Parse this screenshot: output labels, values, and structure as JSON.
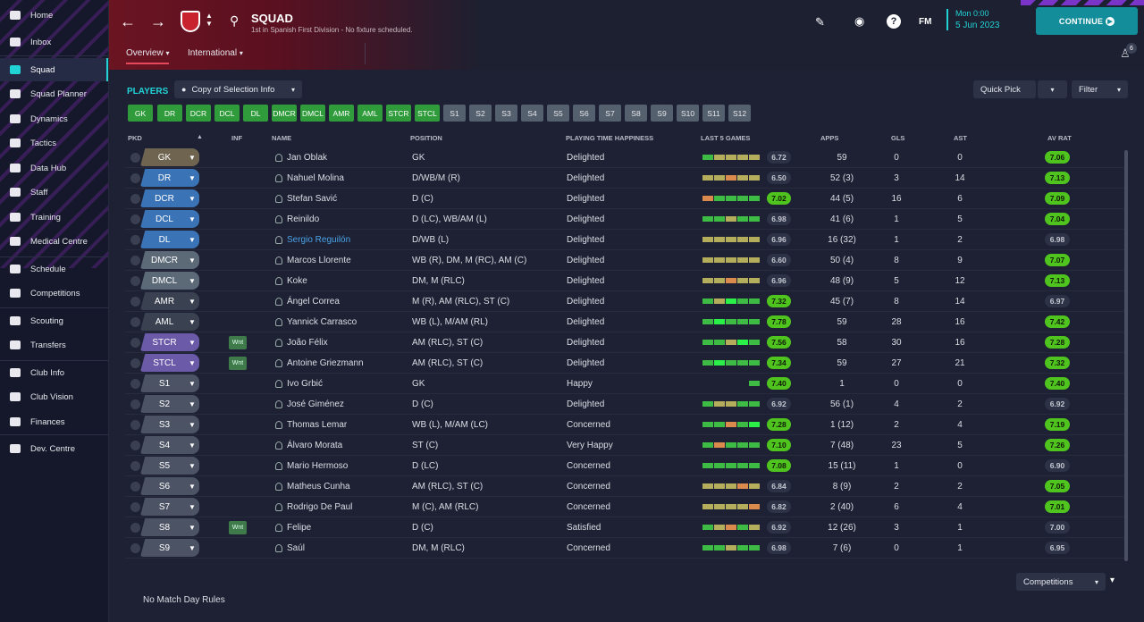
{
  "nav": [
    {
      "label": "Home",
      "icon": "home-icon"
    },
    {
      "label": "Inbox",
      "icon": "inbox-icon"
    },
    {
      "label": "Squad",
      "icon": "squad-icon",
      "active": true
    },
    {
      "label": "Squad Planner",
      "icon": "clipboard-icon"
    },
    {
      "label": "Dynamics",
      "icon": "dynamics-icon"
    },
    {
      "label": "Tactics",
      "icon": "tactics-icon"
    },
    {
      "label": "Data Hub",
      "icon": "data-hub-icon"
    },
    {
      "label": "Staff",
      "icon": "staff-icon"
    },
    {
      "label": "Training",
      "icon": "training-icon"
    },
    {
      "label": "Medical Centre",
      "icon": "medical-icon"
    },
    {
      "label": "Schedule",
      "icon": "calendar-icon"
    },
    {
      "label": "Competitions",
      "icon": "trophy-icon"
    },
    {
      "label": "Scouting",
      "icon": "scouting-icon"
    },
    {
      "label": "Transfers",
      "icon": "transfers-icon"
    },
    {
      "label": "Club Info",
      "icon": "shield-icon"
    },
    {
      "label": "Club Vision",
      "icon": "vision-icon"
    },
    {
      "label": "Finances",
      "icon": "finances-icon"
    },
    {
      "label": "Dev. Centre",
      "icon": "dev-centre-icon"
    }
  ],
  "header": {
    "title": "SQUAD",
    "subtitle": "1st in Spanish First Division - No fixture scheduled.",
    "tabs": [
      "Overview",
      "International"
    ],
    "date_line1": "Mon 0:00",
    "date_line2": "5 Jun 2023",
    "fm": "FM",
    "continue": "CONTINUE",
    "notif_count": "6"
  },
  "toolbar": {
    "players": "PLAYERS",
    "copy": "Copy of Selection Info",
    "quick_pick": "Quick Pick",
    "filter": "Filter"
  },
  "positions": [
    "GK",
    "DR",
    "DCR",
    "DCL",
    "DL",
    "DMCR",
    "DMCL",
    "AMR",
    "AML",
    "STCR",
    "STCL",
    "S1",
    "S2",
    "S3",
    "S4",
    "S5",
    "S6",
    "S7",
    "S8",
    "S9",
    "S10",
    "S11",
    "S12"
  ],
  "columns": {
    "pkd": "PKD",
    "inf": "INF",
    "name": "NAME",
    "position": "POSITION",
    "happiness": "PLAYING TIME HAPPINESS",
    "last5": "LAST 5 GAMES",
    "apps": "APPS",
    "gls": "GLS",
    "ast": "AST",
    "avrat": "AV RAT"
  },
  "colors": {
    "accent": "#22d3d6",
    "continue_bg": "#148d9a",
    "rating_green": "#4fc41e",
    "form_green": "#2fc43a",
    "form_olive": "#b8b05a",
    "form_orange": "#d8884a"
  },
  "players": [
    {
      "sel": "GK",
      "name": "Jan Oblak",
      "pos": "GK",
      "happy": "Delighted",
      "form": [
        "g",
        "o",
        "o",
        "o",
        "o"
      ],
      "fr": "6.72",
      "apps": "59",
      "gls": "0",
      "ast": "0",
      "av": "7.06"
    },
    {
      "sel": "DR",
      "name": "Nahuel Molina",
      "pos": "D/WB/M (R)",
      "happy": "Delighted",
      "form": [
        "o",
        "o",
        "r",
        "o",
        "o"
      ],
      "fr": "6.50",
      "apps": "52 (3)",
      "gls": "3",
      "ast": "14",
      "av": "7.13"
    },
    {
      "sel": "DCR",
      "name": "Stefan Savić",
      "pos": "D (C)",
      "happy": "Delighted",
      "form": [
        "r",
        "g",
        "g",
        "g",
        "g"
      ],
      "fr": "7.02",
      "apps": "44 (5)",
      "gls": "16",
      "ast": "6",
      "av": "7.09"
    },
    {
      "sel": "DCL",
      "name": "Reinildo",
      "pos": "D (LC), WB/AM (L)",
      "happy": "Delighted",
      "form": [
        "g",
        "g",
        "o",
        "g",
        "g"
      ],
      "fr": "6.98",
      "apps": "41 (6)",
      "gls": "1",
      "ast": "5",
      "av": "7.04"
    },
    {
      "sel": "DL",
      "name": "Sergio Reguilón",
      "pos": "D/WB (L)",
      "happy": "Delighted",
      "form": [
        "o",
        "o",
        "o",
        "o",
        "o"
      ],
      "fr": "6.96",
      "apps": "16 (32)",
      "gls": "1",
      "ast": "2",
      "av": "6.98",
      "link": true
    },
    {
      "sel": "DMCR",
      "name": "Marcos Llorente",
      "pos": "WB (R), DM, M (RC), AM (C)",
      "happy": "Delighted",
      "form": [
        "o",
        "o",
        "o",
        "o",
        "o"
      ],
      "fr": "6.60",
      "apps": "50 (4)",
      "gls": "8",
      "ast": "9",
      "av": "7.07"
    },
    {
      "sel": "DMCL",
      "name": "Koke",
      "pos": "DM, M (RLC)",
      "happy": "Delighted",
      "form": [
        "o",
        "o",
        "r",
        "o",
        "o"
      ],
      "fr": "6.96",
      "apps": "48 (9)",
      "gls": "5",
      "ast": "12",
      "av": "7.13"
    },
    {
      "sel": "AMR",
      "name": "Ángel Correa",
      "pos": "M (R), AM (RLC), ST (C)",
      "happy": "Delighted",
      "form": [
        "g",
        "o",
        "G",
        "g",
        "g"
      ],
      "fr": "7.32",
      "apps": "45 (7)",
      "gls": "8",
      "ast": "14",
      "av": "6.97"
    },
    {
      "sel": "AML",
      "name": "Yannick Carrasco",
      "pos": "WB (L), M/AM (RL)",
      "happy": "Delighted",
      "form": [
        "g",
        "G",
        "g",
        "g",
        "g"
      ],
      "fr": "7.78",
      "apps": "59",
      "gls": "28",
      "ast": "16",
      "av": "7.42"
    },
    {
      "sel": "STCR",
      "name": "João Félix",
      "pos": "AM (RLC), ST (C)",
      "happy": "Delighted",
      "form": [
        "g",
        "g",
        "o",
        "G",
        "g"
      ],
      "fr": "7.56",
      "apps": "58",
      "gls": "30",
      "ast": "16",
      "av": "7.28",
      "inf": "Wnt"
    },
    {
      "sel": "STCL",
      "name": "Antoine Griezmann",
      "pos": "AM (RLC), ST (C)",
      "happy": "Delighted",
      "form": [
        "g",
        "G",
        "g",
        "g",
        "g"
      ],
      "fr": "7.34",
      "apps": "59",
      "gls": "27",
      "ast": "21",
      "av": "7.32",
      "inf": "Wnt"
    },
    {
      "sel": "S1",
      "name": "Ivo Grbić",
      "pos": "GK",
      "happy": "Happy",
      "form": [
        "g"
      ],
      "fr": "7.40",
      "apps": "1",
      "gls": "0",
      "ast": "0",
      "av": "7.40"
    },
    {
      "sel": "S2",
      "name": "José Giménez",
      "pos": "D (C)",
      "happy": "Delighted",
      "form": [
        "g",
        "o",
        "o",
        "g",
        "g"
      ],
      "fr": "6.92",
      "apps": "56 (1)",
      "gls": "4",
      "ast": "2",
      "av": "6.92"
    },
    {
      "sel": "S3",
      "name": "Thomas Lemar",
      "pos": "WB (L), M/AM (LC)",
      "happy": "Concerned",
      "form": [
        "g",
        "g",
        "r",
        "g",
        "G"
      ],
      "fr": "7.28",
      "apps": "1 (12)",
      "gls": "2",
      "ast": "4",
      "av": "7.19"
    },
    {
      "sel": "S4",
      "name": "Álvaro Morata",
      "pos": "ST (C)",
      "happy": "Very Happy",
      "form": [
        "g",
        "r",
        "g",
        "g",
        "g"
      ],
      "fr": "7.10",
      "apps": "7 (48)",
      "gls": "23",
      "ast": "5",
      "av": "7.26"
    },
    {
      "sel": "S5",
      "name": "Mario Hermoso",
      "pos": "D (LC)",
      "happy": "Concerned",
      "form": [
        "g",
        "g",
        "g",
        "g",
        "g"
      ],
      "fr": "7.08",
      "apps": "15 (11)",
      "gls": "1",
      "ast": "0",
      "av": "6.90"
    },
    {
      "sel": "S6",
      "name": "Matheus Cunha",
      "pos": "AM (RLC), ST (C)",
      "happy": "Concerned",
      "form": [
        "o",
        "o",
        "o",
        "r",
        "o"
      ],
      "fr": "6.84",
      "apps": "8 (9)",
      "gls": "2",
      "ast": "2",
      "av": "7.05"
    },
    {
      "sel": "S7",
      "name": "Rodrigo De Paul",
      "pos": "M (C), AM (RLC)",
      "happy": "Concerned",
      "form": [
        "o",
        "o",
        "o",
        "o",
        "r"
      ],
      "fr": "6.82",
      "apps": "2 (40)",
      "gls": "6",
      "ast": "4",
      "av": "7.01"
    },
    {
      "sel": "S8",
      "name": "Felipe",
      "pos": "D (C)",
      "happy": "Satisfied",
      "form": [
        "g",
        "o",
        "r",
        "g",
        "o"
      ],
      "fr": "6.92",
      "apps": "12 (26)",
      "gls": "3",
      "ast": "1",
      "av": "7.00",
      "inf": "Wnt"
    },
    {
      "sel": "S9",
      "name": "Saúl",
      "pos": "DM, M (RLC)",
      "happy": "Concerned",
      "form": [
        "g",
        "g",
        "o",
        "g",
        "g"
      ],
      "fr": "6.98",
      "apps": "7 (6)",
      "gls": "0",
      "ast": "1",
      "av": "6.95"
    }
  ],
  "footer": {
    "no_rules": "No Match Day Rules",
    "competitions": "Competitions"
  }
}
